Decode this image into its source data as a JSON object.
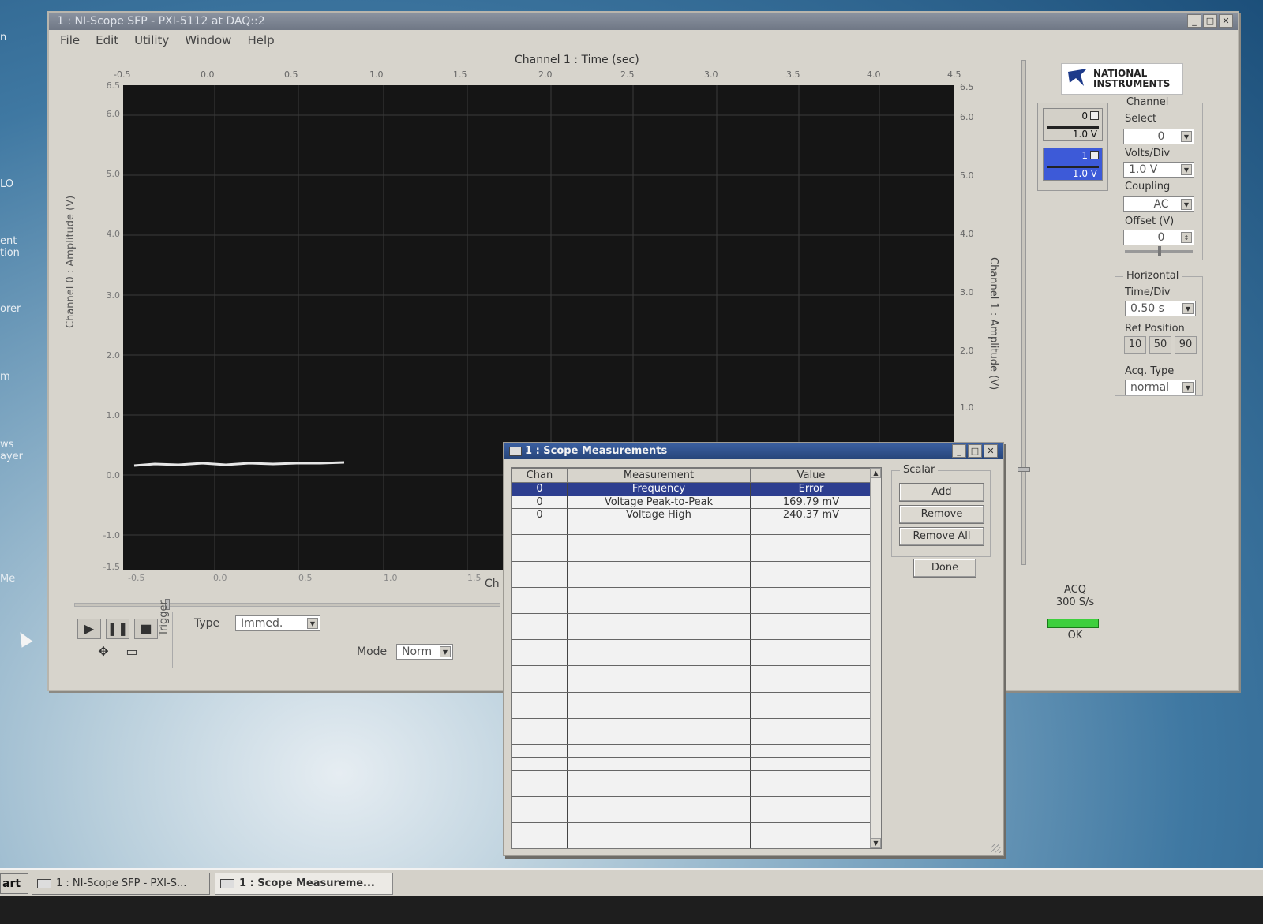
{
  "desktop": {
    "labels": [
      "n",
      "LO",
      "ent",
      "tion",
      "orer",
      "m",
      "ws",
      "ayer",
      "Me"
    ]
  },
  "main_window": {
    "title": "1 : NI-Scope SFP - PXI-5112 at DAQ::2",
    "menu": [
      "File",
      "Edit",
      "Utility",
      "Window",
      "Help"
    ],
    "plot": {
      "title": "Channel 1 : Time (sec)",
      "ylabel_left": "Channel 0 : Amplitude (V)",
      "ylabel_right": "Channel 1 : Amplitude (V)",
      "xlabel_bottom_visible": "Ch",
      "top_ticks": [
        "-0.5",
        "0.0",
        "0.5",
        "1.0",
        "1.5",
        "2.0",
        "2.5",
        "3.0",
        "3.5",
        "4.0",
        "4.5"
      ],
      "bottom_ticks": [
        "-0.5",
        "0.0",
        "0.5",
        "1.0",
        "1.5"
      ],
      "left_ticks": [
        "6.5",
        "6.0",
        "5.0",
        "4.0",
        "3.0",
        "2.0",
        "1.0",
        "0.0",
        "-1.0",
        "-1.5"
      ],
      "right_ticks": [
        "6.5",
        "6.0",
        "5.0",
        "4.0",
        "3.0",
        "2.0",
        "1.0"
      ]
    },
    "trigger": {
      "label": "Trigger",
      "type_label": "Type",
      "type_value": "Immed.",
      "mode_label": "Mode",
      "mode_value": "Norm"
    },
    "logo": "NATIONAL INSTRUMENTS",
    "channels": [
      {
        "num": "0",
        "volts": "1.0 V",
        "active": false
      },
      {
        "num": "1",
        "volts": "1.0 V",
        "active": true
      }
    ],
    "channel_group": {
      "title": "Channel",
      "select_label": "Select",
      "select_value": "0",
      "voltsdiv_label": "Volts/Div",
      "voltsdiv_value": "1.0 V",
      "coupling_label": "Coupling",
      "coupling_value": "AC",
      "offset_label": "Offset (V)",
      "offset_value": "0"
    },
    "horizontal_group": {
      "title": "Horizontal",
      "timediv_label": "Time/Div",
      "timediv_value": "0.50 s",
      "refpos_label": "Ref Position",
      "refpos_options": [
        "10",
        "50",
        "90"
      ],
      "acqtype_label": "Acq. Type",
      "acqtype_value": "normal"
    },
    "acq": {
      "label": "ACQ",
      "rate": "300 S/s",
      "status": "OK"
    }
  },
  "measurements_window": {
    "title": "1 : Scope Measurements",
    "columns": [
      "Chan",
      "Measurement",
      "Value"
    ],
    "rows": [
      {
        "chan": "0",
        "measurement": "Frequency",
        "value": "Error",
        "selected": true
      },
      {
        "chan": "0",
        "measurement": "Voltage Peak-to-Peak",
        "value": "169.79 mV",
        "selected": false
      },
      {
        "chan": "0",
        "measurement": "Voltage High",
        "value": "240.37 mV",
        "selected": false
      }
    ],
    "scalar_title": "Scalar",
    "buttons": {
      "add": "Add",
      "remove": "Remove",
      "remove_all": "Remove All",
      "done": "Done"
    }
  },
  "taskbar": {
    "start": "art",
    "items": [
      "1 : NI-Scope SFP - PXI-S...",
      "1 : Scope Measureme..."
    ]
  },
  "colors": {
    "selection": "#2d3e8f",
    "trace": "#e6e6e6",
    "acq_ok": "#3ecf3e"
  }
}
